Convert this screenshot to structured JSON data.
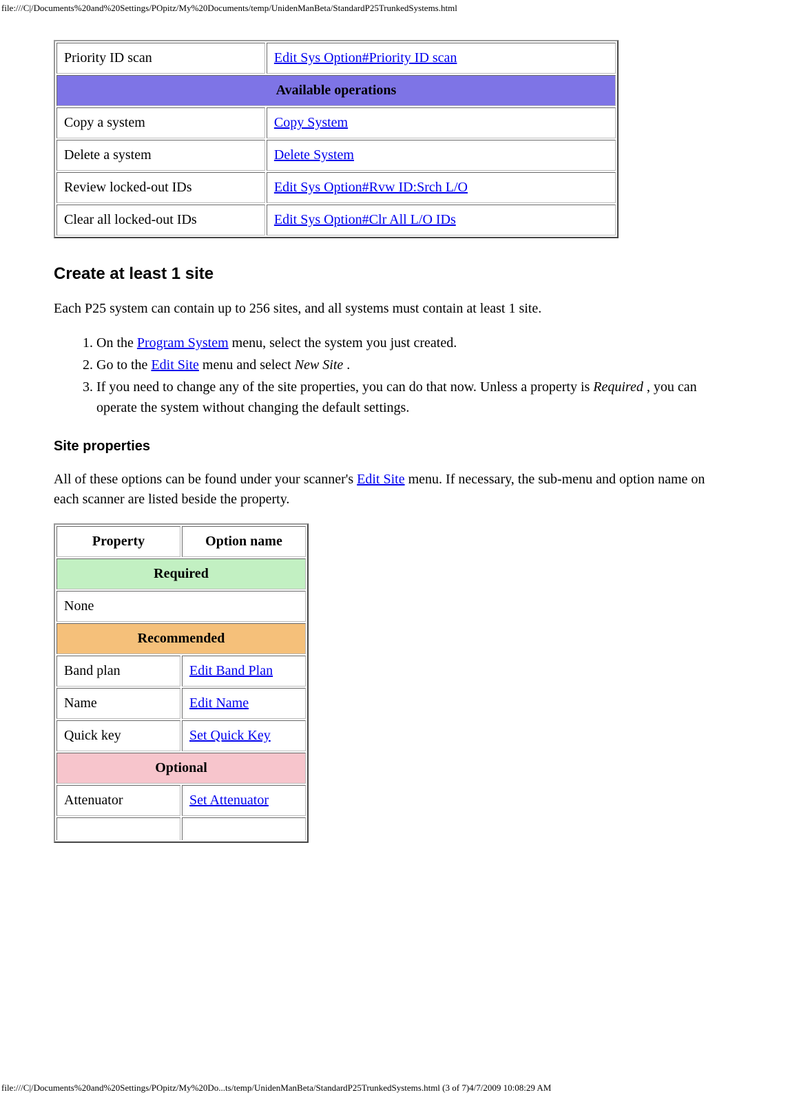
{
  "url_header": "file:///C|/Documents%20and%20Settings/POpitz/My%20Documents/temp/UnidenManBeta/StandardP25TrunkedSystems.html",
  "footer": "file:///C|/Documents%20and%20Settings/POpitz/My%20Do...ts/temp/UnidenManBeta/StandardP25TrunkedSystems.html (3 of 7)4/7/2009 10:08:29 AM",
  "table1": {
    "row_priority_label": "Priority ID scan",
    "row_priority_link": "Edit Sys Option#Priority ID scan",
    "header_avail_ops": "Available operations",
    "row_copy_label": "Copy a system",
    "row_copy_link": "Copy System",
    "row_delete_label": "Delete a system",
    "row_delete_link": "Delete System",
    "row_review_label": "Review locked-out IDs",
    "row_review_link": "Edit Sys Option#Rvw ID:Srch L/O",
    "row_clear_label": "Clear all locked-out IDs",
    "row_clear_link": "Edit Sys Option#Clr All L/O IDs"
  },
  "section_create": {
    "heading": "Create at least 1 site",
    "intro": "Each P25 system can contain up to 256 sites, and all systems must contain at least 1 site.",
    "step1_pre": "On the ",
    "step1_link": "Program System",
    "step1_post": " menu, select the system you just created.",
    "step2_pre": "Go to the ",
    "step2_link": "Edit Site",
    "step2_mid": " menu and select ",
    "step2_em": "New Site",
    "step2_post": " .",
    "step3_pre": "If you need to change any of the site properties, you can do that now. Unless a property is ",
    "step3_em": "Required",
    "step3_post": " , you can operate the system without changing the default settings."
  },
  "section_site_props": {
    "heading": "Site properties",
    "intro_pre": "All of these options can be found under your scanner's ",
    "intro_link": "Edit Site",
    "intro_post": " menu. If necessary, the sub-menu and option name on each scanner are listed beside the property."
  },
  "table2": {
    "th_property": "Property",
    "th_option": "Option name",
    "hdr_required": "Required",
    "row_none": "None",
    "hdr_recommended": "Recommended",
    "row_band_label": "Band plan",
    "row_band_link": "Edit Band Plan",
    "row_name_label": "Name",
    "row_name_link": "Edit Name",
    "row_qkey_label": "Quick key",
    "row_qkey_link": "Set Quick Key",
    "hdr_optional": "Optional",
    "row_att_label": "Attenuator",
    "row_att_link": "Set Attenuator"
  }
}
